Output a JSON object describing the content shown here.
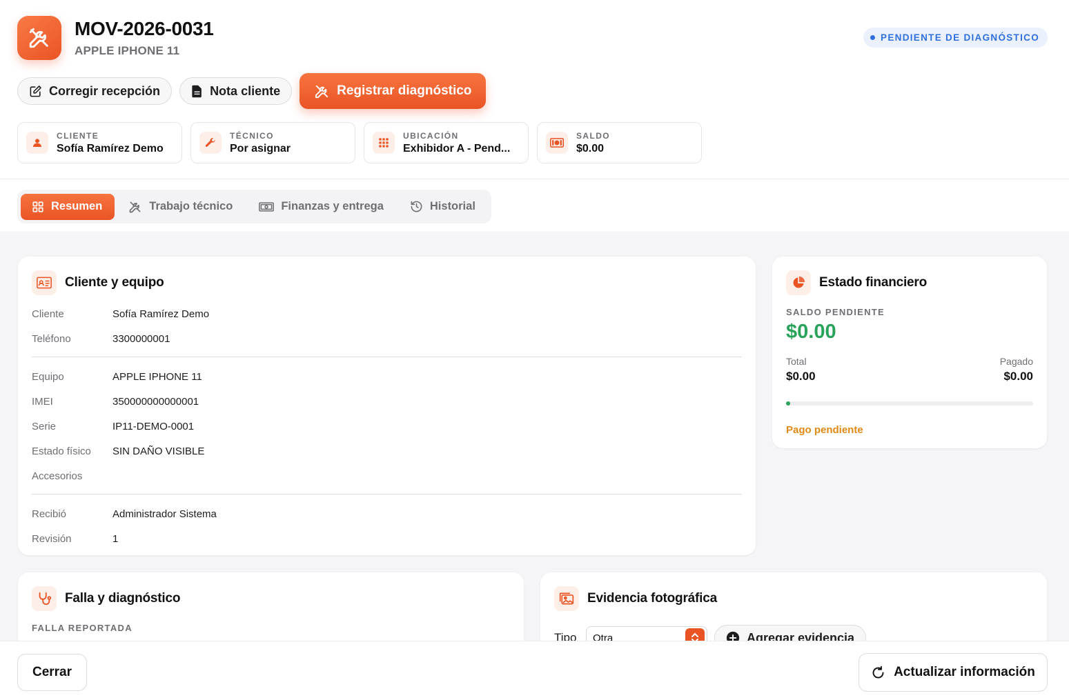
{
  "header": {
    "title": "MOV-2026-0031",
    "subtitle": "APPLE IPHONE 11",
    "status": "PENDIENTE DE DIAGNÓSTICO",
    "accent_color": "#EA5425",
    "status_color": "#2F6FE0"
  },
  "actions": {
    "correct_label": "Corregir recepción",
    "note_label": "Nota cliente",
    "diagnose_label": "Registrar diagnóstico"
  },
  "info_cards": [
    {
      "label": "CLIENTE",
      "value": "Sofía Ramírez Demo",
      "icon": "person-icon"
    },
    {
      "label": "TÉCNICO",
      "value": "Por asignar",
      "icon": "wrench-icon"
    },
    {
      "label": "UBICACIÓN",
      "value": "Exhibidor A - Pend...",
      "icon": "grid-icon"
    },
    {
      "label": "SALDO",
      "value": "$0.00",
      "icon": "cash-icon"
    }
  ],
  "tabs": [
    {
      "label": "Resumen",
      "icon": "dashboard-icon",
      "active": true
    },
    {
      "label": "Trabajo técnico",
      "icon": "tools-icon",
      "active": false
    },
    {
      "label": "Finanzas y entrega",
      "icon": "cash-icon",
      "active": false
    },
    {
      "label": "Historial",
      "icon": "history-icon",
      "active": false
    }
  ],
  "client_card": {
    "title": "Cliente y equipo",
    "rows_client": [
      {
        "key": "Cliente",
        "value": "Sofía Ramírez Demo"
      },
      {
        "key": "Teléfono",
        "value": "3300000001"
      }
    ],
    "rows_device": [
      {
        "key": "Equipo",
        "value": "APPLE IPHONE 11"
      },
      {
        "key": "IMEI",
        "value": "350000000000001"
      },
      {
        "key": "Serie",
        "value": "IP11-DEMO-0001"
      },
      {
        "key": "Estado físico",
        "value": "SIN DAÑO VISIBLE"
      },
      {
        "key": "Accesorios",
        "value": ""
      }
    ],
    "rows_meta": [
      {
        "key": "Recibió",
        "value": "Administrador Sistema"
      },
      {
        "key": "Revisión",
        "value": "1"
      }
    ]
  },
  "finance_card": {
    "title": "Estado financiero",
    "pending_label": "SALDO PENDIENTE",
    "pending_value": "$0.00",
    "total_label": "Total",
    "total_value": "$0.00",
    "paid_label": "Pagado",
    "paid_value": "$0.00",
    "paid_fraction": 0,
    "status": "Pago pendiente",
    "positive_color": "#2AA35A",
    "warning_color": "#E08A16"
  },
  "fault_card": {
    "title": "Falla y diagnóstico",
    "reported_label": "FALLA REPORTADA"
  },
  "evidence_card": {
    "title": "Evidencia fotográfica",
    "type_label": "Tipo",
    "type_value": "Otra",
    "add_label": "Agregar evidencia"
  },
  "footer": {
    "close_label": "Cerrar",
    "refresh_label": "Actualizar información"
  }
}
